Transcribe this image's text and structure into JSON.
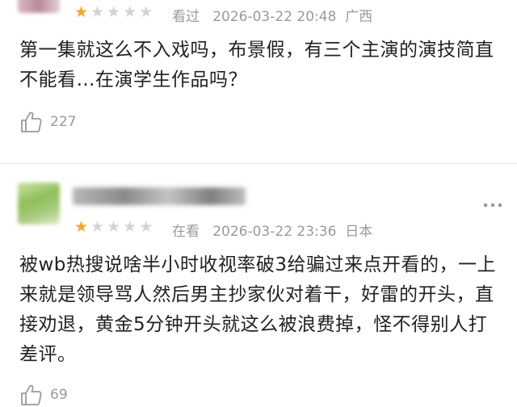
{
  "reviews": [
    {
      "rating": 1,
      "max_rating": 5,
      "status": "看过",
      "date": "2026-03-22 20:48",
      "location": "广西",
      "text": "第一集就这么不入戏吗，布景假，有三个主演的演技简直不能看…在演学生作品吗？",
      "likes": "227"
    },
    {
      "rating": 1,
      "max_rating": 5,
      "status": "在看",
      "date": "2026-03-22 23:36",
      "location": "日本",
      "text": "被wb热搜说啥半小时收视率破3给骗过来点开看的，一上来就是领导骂人然后男主抄家伙对着干，好雷的开头，直接劝退，黄金5分钟开头就这么被浪费掉，怪不得别人打差评。",
      "likes": "69"
    }
  ],
  "icons": {
    "like": "thumbs-up-icon",
    "more": "more-dots-icon",
    "star": "star-icon"
  },
  "colors": {
    "star_on": "#f5a623",
    "star_off": "#d3d3d3",
    "meta": "#9a9a9a"
  }
}
